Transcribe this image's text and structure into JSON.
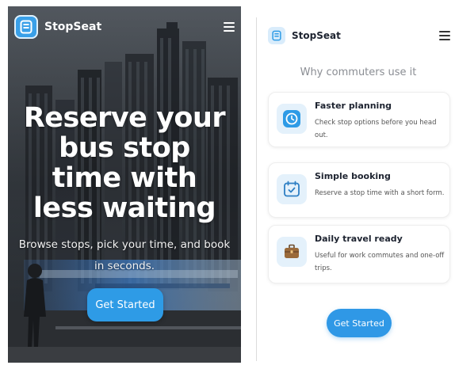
{
  "left_screen": {
    "brand": "StopSeat",
    "hero_title": "Reserve your\nbus stop\ntime with\nless waiting",
    "hero_subtitle_line1": "Browse stops, pick your time, and book",
    "hero_subtitle_line2": "in seconds.",
    "cta_label": "Get Started",
    "icons": {
      "logo": "bus-card-icon",
      "menu": "hamburger-menu-icon"
    }
  },
  "right_screen": {
    "brand": "StopSeat",
    "section_title": "Why commuters use it",
    "features": [
      {
        "title": "Faster planning",
        "description": "Check stop options before you head out.",
        "icon": "clock-icon"
      },
      {
        "title": "Simple booking",
        "description": "Reserve a stop time with a short form.",
        "icon": "calendar-check-icon"
      },
      {
        "title": "Daily travel ready",
        "description": "Useful for work commutes and one-off trips.",
        "icon": "briefcase-icon"
      }
    ],
    "cta_label": "Get Started",
    "icons": {
      "logo": "bus-card-icon",
      "menu": "hamburger-menu-icon"
    }
  },
  "colors": {
    "accent": "#2e9be6",
    "icon_tile_bg": "#e4f1fb",
    "heading_text": "#1d2330",
    "muted_text": "#8a8d93"
  }
}
